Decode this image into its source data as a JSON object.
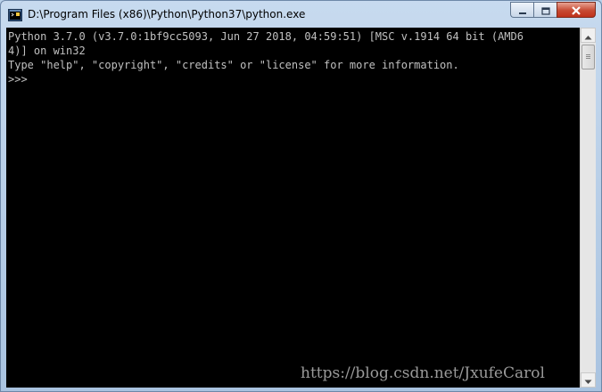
{
  "window": {
    "title": "D:\\Program Files (x86)\\Python\\Python37\\python.exe",
    "icon": "python-console-icon",
    "buttons": {
      "minimize_icon": "minimize-icon",
      "maximize_icon": "maximize-icon",
      "close_icon": "close-icon"
    }
  },
  "console": {
    "background": "#000000",
    "foreground": "#c0c0c0",
    "lines": [
      "Python 3.7.0 (v3.7.0:1bf9cc5093, Jun 27 2018, 04:59:51) [MSC v.1914 64 bit (AMD6",
      "4)] on win32",
      "Type \"help\", \"copyright\", \"credits\" or \"license\" for more information.",
      ">>>"
    ]
  },
  "scrollbar": {
    "up_icon": "scroll-up-arrow-icon",
    "down_icon": "scroll-down-arrow-icon"
  },
  "watermark": "https://blog.csdn.net/JxufeCarol"
}
